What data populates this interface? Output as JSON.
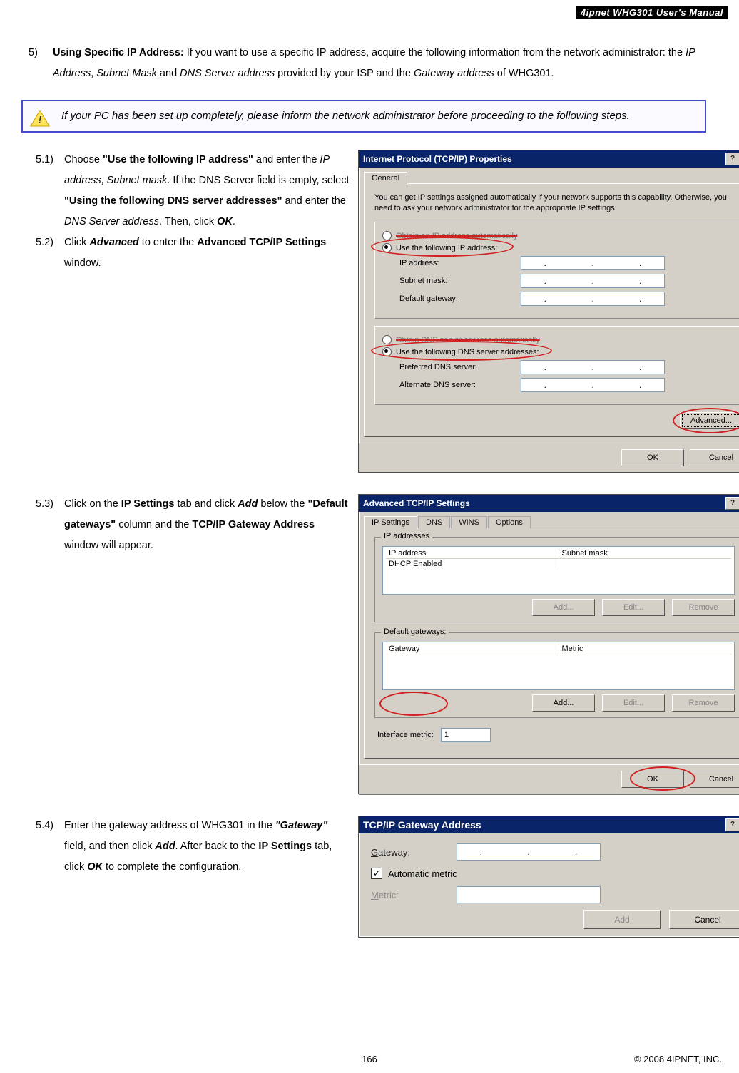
{
  "header_band": "4ipnet WHG301 User's Manual",
  "intro": {
    "num": "5)",
    "bold_lead": "Using Specific IP Address: ",
    "t1": "If you want to use a specific IP address, acquire the following information from the network administrator: the ",
    "i1": "IP Address",
    "c1": ", ",
    "i2": "Subnet Mask",
    "t2": " and ",
    "i3": "DNS Server address",
    "t3": " provided by your ISP and the ",
    "i4": "Gateway address",
    "t4": " of WHG301."
  },
  "note": "If your PC has been set up completely, please inform the network administrator before proceeding to the following steps.",
  "s51": {
    "num": "5.1)",
    "t1": "Choose ",
    "q1": "\"Use the following IP address\"",
    "t2": " and enter the ",
    "i1": "IP address",
    "c1": ", ",
    "i2": "Subnet mask",
    "t3": ". If the DNS Server field is empty, select ",
    "q2": "\"Using the following DNS server addresses\"",
    "t4": " and enter the ",
    "i3": "DNS Server address",
    "t5": ". Then, click ",
    "b1": "OK",
    "dot": "."
  },
  "s52": {
    "num": "5.2)",
    "t1": "Click ",
    "b1": "Advanced",
    "t2": " to enter the ",
    "b2": "Advanced TCP/IP Settings",
    "t3": " window."
  },
  "s53": {
    "num": "5.3)",
    "t1": "Click on the ",
    "b1": "IP Settings",
    "t2": " tab and click ",
    "b2": "Add",
    "t3": " below the ",
    "q1": "\"Default gateways\"",
    "t4": " column and the ",
    "b3": "TCP/IP Gateway Address",
    "t5": " window will appear."
  },
  "s54": {
    "num": "5.4)",
    "t1": "Enter the gateway address of WHG301 in the ",
    "q1": "\"Gateway\"",
    "t2": " field, and then click ",
    "b1": "Add",
    "t3": ". After back to the ",
    "b2": "IP Settings",
    "t4": " tab, click ",
    "b3": "OK",
    "t5": " to complete the configuration."
  },
  "dlg1": {
    "title": "Internet Protocol (TCP/IP) Properties",
    "tab_general": "General",
    "blurb": "You can get IP settings assigned automatically if your network supports this capability. Otherwise, you need to ask your network administrator for the appropriate IP settings.",
    "r_auto_ip": "Obtain an IP address automatically",
    "r_use_ip": "Use the following IP address:",
    "lab_ip": "IP address:",
    "lab_mask": "Subnet mask:",
    "lab_gw": "Default gateway:",
    "r_auto_dns": "Obtain DNS server address automatically",
    "r_use_dns": "Use the following DNS server addresses:",
    "lab_pdns": "Preferred DNS server:",
    "lab_adns": "Alternate DNS server:",
    "btn_adv": "Advanced...",
    "btn_ok": "OK",
    "btn_cancel": "Cancel"
  },
  "dlg2": {
    "title": "Advanced TCP/IP Settings",
    "tab_ip": "IP Settings",
    "tab_dns": "DNS",
    "tab_wins": "WINS",
    "tab_opt": "Options",
    "fs_ip": "IP addresses",
    "col_ip": "IP address",
    "col_mask": "Subnet mask",
    "cell_dhcp": "DHCP Enabled",
    "fs_gw": "Default gateways:",
    "col_gw": "Gateway",
    "col_metric": "Metric",
    "btn_add": "Add...",
    "btn_edit": "Edit...",
    "btn_remove": "Remove",
    "lab_ifmetric": "Interface metric:",
    "ifmetric_val": "1",
    "btn_ok": "OK",
    "btn_cancel": "Cancel"
  },
  "dlg3": {
    "title": "TCP/IP Gateway Address",
    "lab_gw": "Gateway:",
    "cb_auto": "Automatic metric",
    "lab_metric": "Metric:",
    "btn_add": "Add",
    "btn_cancel": "Cancel"
  },
  "page_num": "166",
  "copyright": "© 2008 4IPNET, INC."
}
